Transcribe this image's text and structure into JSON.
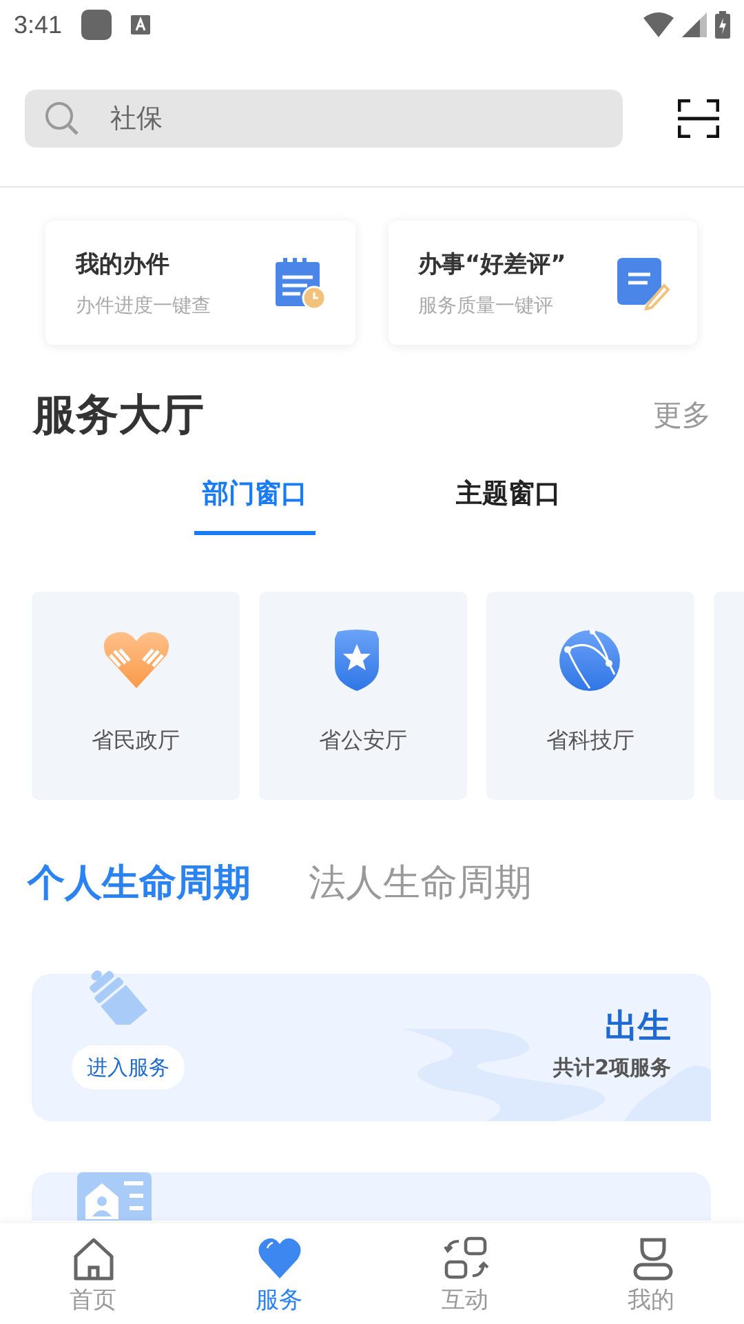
{
  "status_bar": {
    "time": "3:41"
  },
  "search": {
    "placeholder": "社保"
  },
  "quick_cards": [
    {
      "kind": "calendar",
      "title": "我的办件",
      "subtitle": "办件进度一键查"
    },
    {
      "kind": "note",
      "title": "办事“好差评”",
      "subtitle": "服务质量一键评"
    }
  ],
  "hall": {
    "title": "服务大厅",
    "more": "更多",
    "tabs": [
      {
        "label": "部门窗口",
        "selected": true
      },
      {
        "label": "主题窗口",
        "selected": false
      }
    ],
    "departments": [
      {
        "kind": "heart",
        "name": "省民政厅"
      },
      {
        "kind": "shield",
        "name": "省公安厅"
      },
      {
        "kind": "globe",
        "name": "省科技厅"
      },
      {
        "kind": "partial"
      }
    ]
  },
  "lifecycle_tabs": [
    {
      "label": "个人生命周期",
      "selected": true
    },
    {
      "label": "法人生命周期",
      "selected": false
    }
  ],
  "services": [
    {
      "kind": "bottle",
      "title": "出生",
      "count": "共计2项服务",
      "button": "进入服务"
    },
    {
      "kind": "house"
    }
  ],
  "nav": [
    {
      "kind": "home",
      "label": "首页",
      "selected": false
    },
    {
      "kind": "heart",
      "label": "服务",
      "selected": true
    },
    {
      "kind": "swap",
      "label": "互动",
      "selected": false
    },
    {
      "kind": "user",
      "label": "我的",
      "selected": false
    }
  ]
}
